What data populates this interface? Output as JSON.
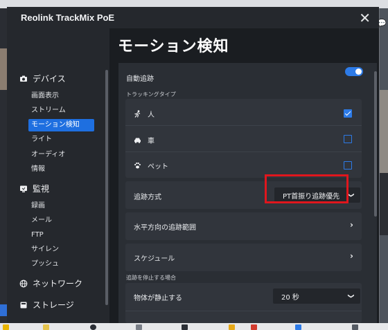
{
  "window": {
    "title": "Reolink TrackMix PoE",
    "close_icon": "close-icon"
  },
  "sidebar": {
    "groups": [
      {
        "label": "デバイス",
        "icon": "camera-icon",
        "items": [
          "画面表示",
          "ストリーム",
          "モーション検知",
          "ライト",
          "オーディオ",
          "情報"
        ]
      },
      {
        "label": "監視",
        "icon": "monitor-icon",
        "items": [
          "録画",
          "メール",
          "FTP",
          "サイレン",
          "プッシュ"
        ]
      },
      {
        "label": "ネットワーク",
        "icon": "globe-icon",
        "items": []
      },
      {
        "label": "ストレージ",
        "icon": "storage-icon",
        "items": []
      }
    ],
    "active_item": "モーション検知"
  },
  "main": {
    "title": "モーション検知",
    "auto_tracking": {
      "label": "自動追跡",
      "enabled": true
    },
    "tracking_type": {
      "label": "トラッキングタイプ",
      "options": [
        {
          "label": "人",
          "icon": "person-icon",
          "checked": true
        },
        {
          "label": "車",
          "icon": "car-icon",
          "checked": false
        },
        {
          "label": "ペット",
          "icon": "paw-icon",
          "checked": false
        }
      ]
    },
    "tracking_method": {
      "label": "追跡方式",
      "value": "PT首振り追跡優先"
    },
    "horizontal_range": {
      "label": "水平方向の追跡範囲"
    },
    "schedule": {
      "label": "スケジュール"
    },
    "stop_section": {
      "label": "追跡を停止する場合"
    },
    "object_stationary": {
      "label": "物体が静止する",
      "value": "20 秒"
    }
  },
  "colors": {
    "accent": "#2d7be8",
    "highlight": "#e0161d",
    "bg": "#1f2227"
  }
}
